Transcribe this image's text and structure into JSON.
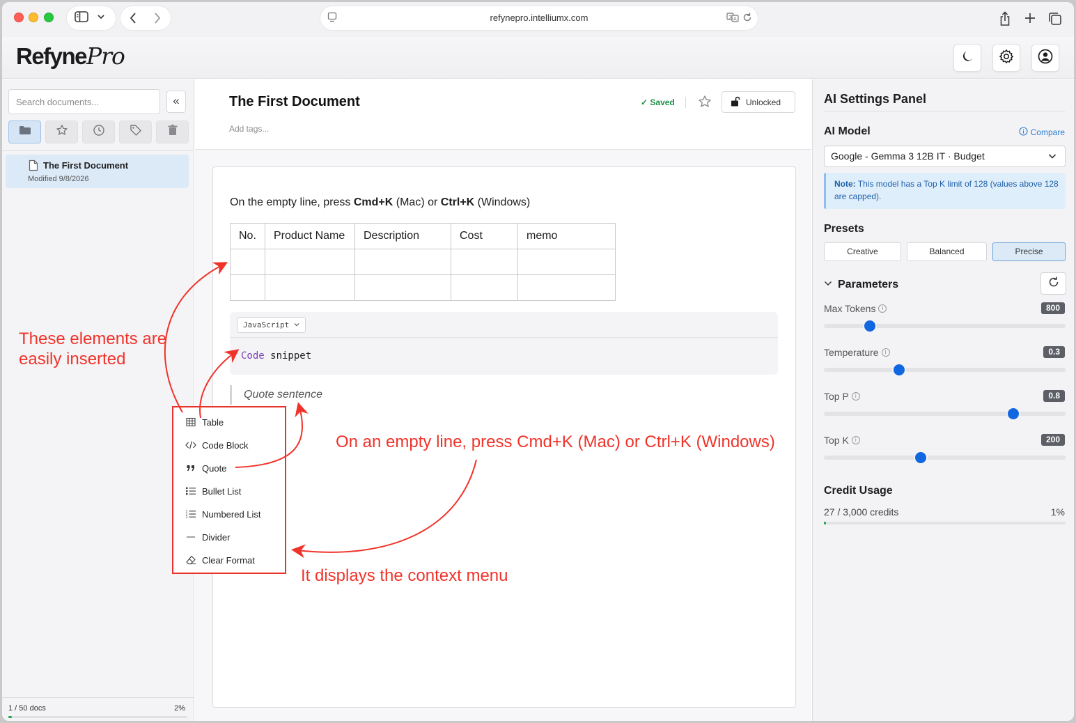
{
  "browser": {
    "url": "refynepro.intelliumx.com",
    "icons": [
      "sidebar-toggle-icon",
      "chevron-down-icon",
      "back-icon",
      "forward-icon",
      "page-icon",
      "translate-icon",
      "reload-icon",
      "share-icon",
      "new-tab-icon",
      "tabs-overview-icon"
    ]
  },
  "app": {
    "logo_main": "Refyne",
    "logo_accent": "Pro",
    "header_buttons": [
      "dark-mode-icon",
      "settings-icon",
      "account-icon"
    ]
  },
  "sidebar": {
    "search_placeholder": "Search documents...",
    "collapse_label": "«",
    "filters": [
      "folder-icon",
      "star-icon",
      "clock-icon",
      "tag-icon",
      "trash-icon"
    ],
    "documents": [
      {
        "title": "The First Document",
        "modified": "Modified 9/8/2026"
      }
    ],
    "footer": {
      "count": "1 / 50 docs",
      "percent": "2%",
      "usage_fraction": 0.02
    }
  },
  "document": {
    "title": "The First Document",
    "tags_placeholder": "Add tags...",
    "status": "✓ Saved",
    "lock_label": "Unlocked",
    "instruction": {
      "pre": "On the empty line, press ",
      "key1": "Cmd+K",
      "mid1": " (Mac) or ",
      "key2": "Ctrl+K",
      "post": " (Windows)"
    },
    "table": {
      "headers": [
        "No.",
        "Product Name",
        "Description",
        "Cost",
        "memo"
      ],
      "rows": [
        [
          "",
          "",
          "",
          "",
          ""
        ],
        [
          "",
          "",
          "",
          "",
          ""
        ]
      ]
    },
    "code": {
      "language": "JavaScript",
      "keyword": "Code",
      "rest": " snippet"
    },
    "quote": "Quote sentence"
  },
  "context_menu": {
    "items": [
      {
        "label": "Table",
        "icon": "table-icon"
      },
      {
        "label": "Code Block",
        "icon": "code-icon"
      },
      {
        "label": "Quote",
        "icon": "quote-icon"
      },
      {
        "label": "Bullet List",
        "icon": "bullet-list-icon"
      },
      {
        "label": "Numbered List",
        "icon": "numbered-list-icon"
      },
      {
        "label": "Divider",
        "icon": "divider-icon"
      },
      {
        "label": "Clear Format",
        "icon": "eraser-icon"
      }
    ]
  },
  "annotations": {
    "left_line1": "These elements are",
    "left_line2": "easily inserted",
    "right": "On an empty line, press Cmd+K (Mac) or Ctrl+K (Windows)",
    "bottom": "It displays the context menu",
    "color": "#f0332a"
  },
  "ai_panel": {
    "title": "AI Settings Panel",
    "model_label": "AI Model",
    "compare_label": "Compare",
    "model_value": "Google - Gemma 3 12B IT · Budget",
    "note_bold": "Note:",
    "note_text": " This model has a Top K limit of 128 (values above 128 are capped).",
    "presets_label": "Presets",
    "presets": [
      "Creative",
      "Balanced",
      "Precise"
    ],
    "active_preset": "Precise",
    "parameters_label": "Parameters",
    "params": [
      {
        "label": "Max Tokens",
        "value": "800",
        "level": 0.19
      },
      {
        "label": "Temperature",
        "value": "0.3",
        "level": 0.31
      },
      {
        "label": "Top P",
        "value": "0.8",
        "level": 0.785
      },
      {
        "label": "Top K",
        "value": "200",
        "level": 0.4
      }
    ],
    "credit_label": "Credit Usage",
    "credit_text": "27 / 3,000 credits",
    "credit_pct": "1%",
    "credit_fraction": 0.01
  }
}
